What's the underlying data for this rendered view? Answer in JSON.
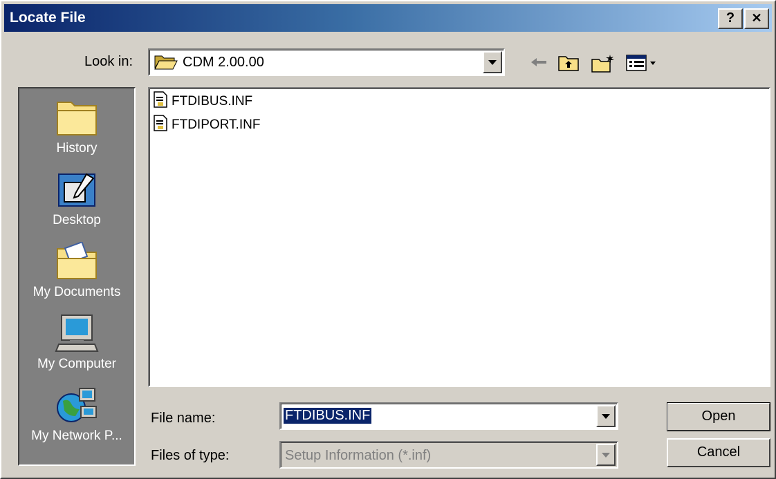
{
  "window": {
    "title": "Locate File",
    "help_label": "?",
    "close_label": "✕"
  },
  "lookin": {
    "label": "Look in:",
    "value": "CDM 2.00.00"
  },
  "toolbar": {
    "icons": [
      "back-icon",
      "up-folder-icon",
      "new-folder-icon",
      "view-menu-icon"
    ]
  },
  "places": [
    {
      "label": "History",
      "icon": "history-folder-icon"
    },
    {
      "label": "Desktop",
      "icon": "desktop-icon"
    },
    {
      "label": "My Documents",
      "icon": "my-documents-icon"
    },
    {
      "label": "My Computer",
      "icon": "my-computer-icon"
    },
    {
      "label": "My Network P...",
      "icon": "network-places-icon"
    }
  ],
  "files": [
    {
      "name": "FTDIBUS.INF",
      "icon": "inf-file-icon"
    },
    {
      "name": "FTDIPORT.INF",
      "icon": "inf-file-icon"
    }
  ],
  "filename": {
    "label": "File name:",
    "value": "FTDIBUS.INF"
  },
  "filetype": {
    "label": "Files of type:",
    "value": "Setup Information (*.inf)"
  },
  "buttons": {
    "open": "Open",
    "cancel": "Cancel"
  },
  "colors": {
    "title_start": "#0a246a",
    "title_end": "#a6caf0",
    "face": "#d4d0c8",
    "selection": "#0a246a"
  }
}
